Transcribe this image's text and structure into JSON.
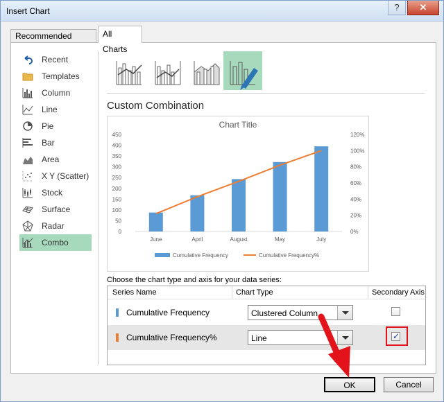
{
  "window": {
    "title": "Insert Chart",
    "help_label": "?",
    "close_label": "✕"
  },
  "tabs": [
    {
      "label": "Recommended Charts",
      "selected": false
    },
    {
      "label": "All Charts",
      "selected": true
    }
  ],
  "sidebar": {
    "items": [
      {
        "label": "Recent",
        "icon": "undo-icon"
      },
      {
        "label": "Templates",
        "icon": "folder-icon"
      },
      {
        "label": "Column",
        "icon": "column-chart-icon"
      },
      {
        "label": "Line",
        "icon": "line-chart-icon"
      },
      {
        "label": "Pie",
        "icon": "pie-chart-icon"
      },
      {
        "label": "Bar",
        "icon": "bar-chart-icon"
      },
      {
        "label": "Area",
        "icon": "area-chart-icon"
      },
      {
        "label": "X Y (Scatter)",
        "icon": "scatter-chart-icon"
      },
      {
        "label": "Stock",
        "icon": "stock-chart-icon"
      },
      {
        "label": "Surface",
        "icon": "surface-chart-icon"
      },
      {
        "label": "Radar",
        "icon": "radar-chart-icon"
      },
      {
        "label": "Combo",
        "icon": "combo-chart-icon",
        "selected": true
      }
    ]
  },
  "thumbnails": [
    {
      "name": "clustered-column-line-icon"
    },
    {
      "name": "clustered-column-line-secondary-icon"
    },
    {
      "name": "stacked-area-clustered-column-icon"
    },
    {
      "name": "custom-combination-icon",
      "selected": true
    }
  ],
  "main": {
    "section_title": "Custom Combination",
    "series_prompt": "Choose the chart type and axis for your data series:"
  },
  "colors": {
    "bar": "#5b9bd5",
    "line": "#ed7d31",
    "selected": "#a7dabd",
    "highlight": "#e3131b"
  },
  "chart_data": {
    "type": "bar",
    "title": "Chart Title",
    "categories": [
      "June",
      "April",
      "August",
      "May",
      "July"
    ],
    "series": [
      {
        "name": "Cumulative Frequency",
        "type": "bar",
        "axis": "primary",
        "values": [
          88,
          168,
          243,
          322,
          395
        ]
      },
      {
        "name": "Cumulative Frequency%",
        "type": "line",
        "axis": "secondary",
        "values": [
          22,
          43,
          62,
          82,
          100
        ]
      }
    ],
    "ylim": [
      0,
      450
    ],
    "yticks": [
      "450",
      "400",
      "350",
      "300",
      "250",
      "200",
      "150",
      "100",
      "50",
      "0"
    ],
    "y2lim": [
      0,
      120
    ],
    "y2ticks": [
      "120%",
      "100%",
      "80%",
      "60%",
      "40%",
      "20%",
      "0%"
    ],
    "grid": false,
    "legend": "bottom"
  },
  "series_table": {
    "headers": {
      "name": "Series Name",
      "type": "Chart Type",
      "axis": "Secondary Axis"
    },
    "rows": [
      {
        "name": "Cumulative Frequency",
        "chart_type": "Clustered Column",
        "secondary": false,
        "color": "#5b9bd5"
      },
      {
        "name": "Cumulative Frequency%",
        "chart_type": "Line",
        "secondary": true,
        "color": "#ed7d31"
      }
    ]
  },
  "buttons": {
    "ok": "OK",
    "cancel": "Cancel"
  }
}
